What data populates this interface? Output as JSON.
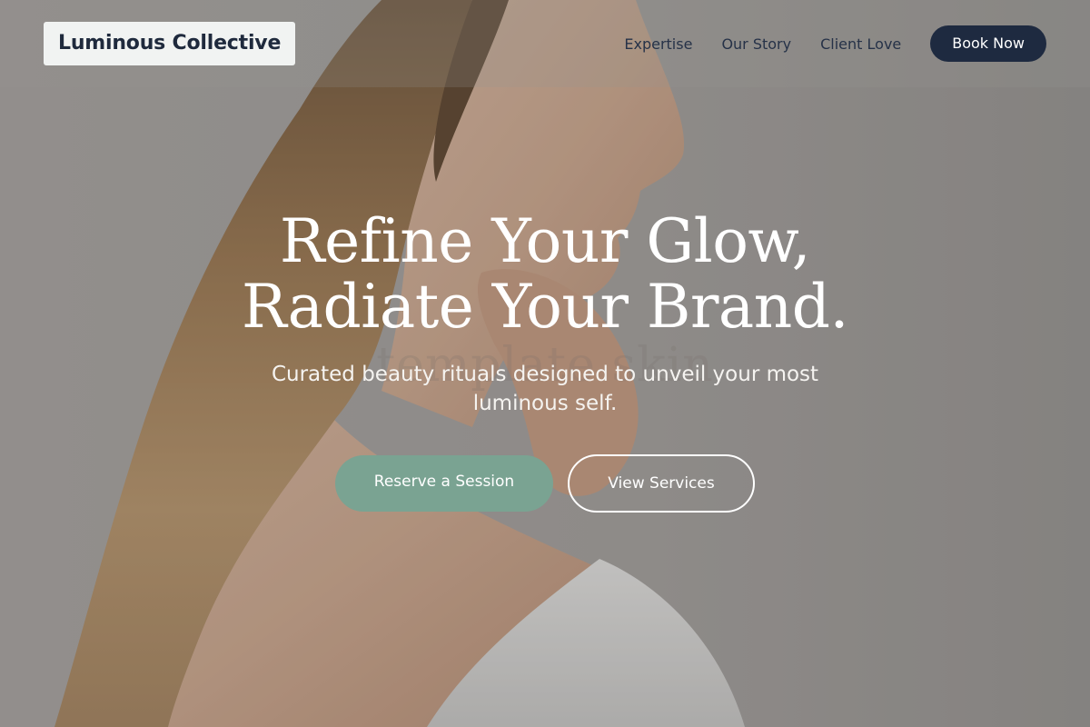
{
  "brand": {
    "name": "Luminous Collective"
  },
  "nav": {
    "items": [
      {
        "label": "Expertise"
      },
      {
        "label": "Our Story"
      },
      {
        "label": "Client Love"
      }
    ],
    "book_label": "Book Now"
  },
  "hero": {
    "headline_line1": "Refine Your Glow,",
    "headline_line2": "Radiate Your Brand.",
    "watermark": "template skin",
    "subheadline": "Curated beauty rituals designed to unveil your most luminous self.",
    "primary_cta": "Reserve a Session",
    "secondary_cta": "View Services"
  },
  "colors": {
    "navy": "#1e2a40",
    "sage": "#7aa392",
    "white": "#ffffff"
  }
}
